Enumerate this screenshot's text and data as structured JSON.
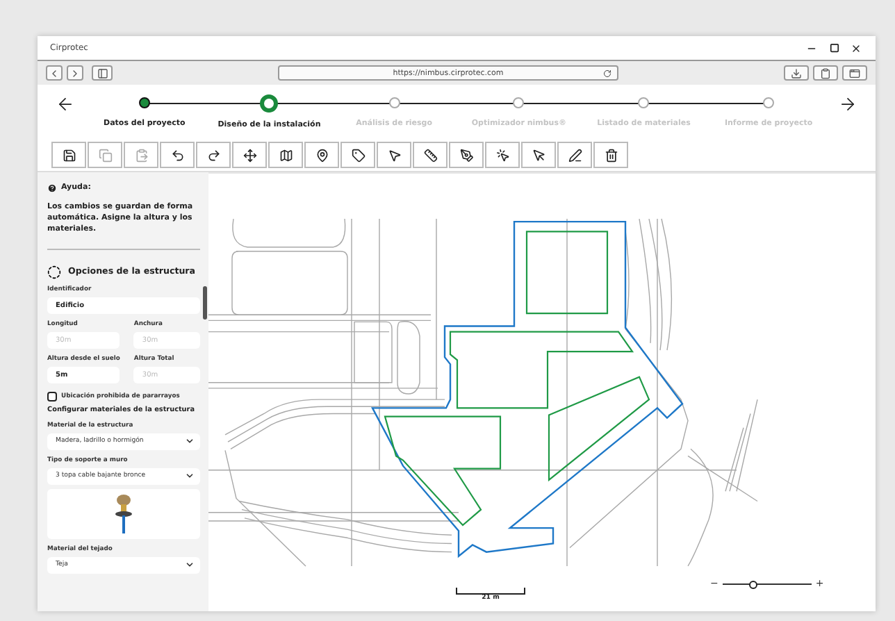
{
  "window": {
    "title": "Cirprotec",
    "url": "https://nimbus.cirprotec.com"
  },
  "steps": [
    {
      "label": "Datos del proyecto",
      "completed": true,
      "selected": false
    },
    {
      "label": "Diseño de la instalación",
      "completed": false,
      "selected": true
    },
    {
      "label": "Análisis de riesgo",
      "completed": false,
      "selected": false
    },
    {
      "label": "Optimizador nimbus®",
      "completed": false,
      "selected": false
    },
    {
      "label": "Listado de materiales",
      "completed": false,
      "selected": false
    },
    {
      "label": "Informe de proyecto",
      "completed": false,
      "selected": false
    }
  ],
  "toolbar": [
    {
      "disabled": false
    },
    {
      "disabled": true
    },
    {
      "disabled": true
    },
    {
      "disabled": false
    },
    {
      "disabled": false
    },
    {
      "disabled": false
    },
    {
      "disabled": false
    },
    {
      "disabled": false
    },
    {
      "disabled": false
    },
    {
      "disabled": false
    },
    {
      "disabled": false
    },
    {
      "disabled": false
    },
    {
      "disabled": false
    },
    {
      "disabled": false
    },
    {
      "disabled": false
    },
    {
      "disabled": false
    }
  ],
  "help": {
    "title": "Ayuda:",
    "text": "Los cambios se guardan de forma automática. Asigne la altura y los materiales."
  },
  "structure": {
    "title": "Opciones de la estructura",
    "identifier": {
      "label": "Identificador",
      "value": "Edificio"
    },
    "length": {
      "label": "Longitud",
      "placeholder": "30m"
    },
    "width": {
      "label": "Anchura",
      "placeholder": "30m"
    },
    "height_ground": {
      "label": "Altura desde el suelo",
      "value": "5m"
    },
    "height_total": {
      "label": "Altura Total",
      "placeholder": "30m"
    },
    "forbidden": {
      "label": "Ubicación prohibida de pararrayos",
      "checked": false
    },
    "materials_title": "Configurar materiales de la estructura",
    "structure_material": {
      "label": "Material de la estructura",
      "value": "Madera, ladrillo o hormigón"
    },
    "support": {
      "label": "Tipo de soporte a muro",
      "value": "3 topa cable bajante bronce"
    },
    "roof": {
      "label": "Material del tejado",
      "value": "Teja"
    }
  },
  "map": {
    "scale": "21 m",
    "zoom": {
      "minus": "−",
      "plus": "+",
      "level": 0.35
    }
  }
}
